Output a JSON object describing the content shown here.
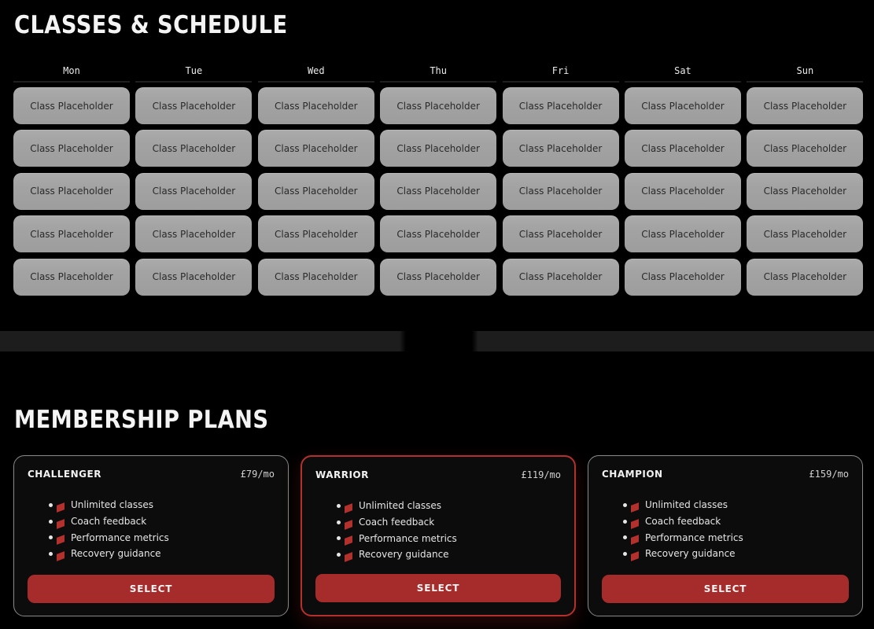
{
  "schedule": {
    "title": "CLASSES & SCHEDULE",
    "days": [
      "Mon",
      "Tue",
      "Wed",
      "Thu",
      "Fri",
      "Sat",
      "Sun"
    ],
    "rows": [
      [
        "Class Placeholder",
        "Class Placeholder",
        "Class Placeholder",
        "Class Placeholder",
        "Class Placeholder",
        "Class Placeholder",
        "Class Placeholder"
      ],
      [
        "Class Placeholder",
        "Class Placeholder",
        "Class Placeholder",
        "Class Placeholder",
        "Class Placeholder",
        "Class Placeholder",
        "Class Placeholder"
      ],
      [
        "Class Placeholder",
        "Class Placeholder",
        "Class Placeholder",
        "Class Placeholder",
        "Class Placeholder",
        "Class Placeholder",
        "Class Placeholder"
      ],
      [
        "Class Placeholder",
        "Class Placeholder",
        "Class Placeholder",
        "Class Placeholder",
        "Class Placeholder",
        "Class Placeholder",
        "Class Placeholder"
      ],
      [
        "Class Placeholder",
        "Class Placeholder",
        "Class Placeholder",
        "Class Placeholder",
        "Class Placeholder",
        "Class Placeholder",
        "Class Placeholder"
      ]
    ]
  },
  "membership": {
    "title": "MEMBERSHIP PLANS",
    "plans": [
      {
        "name": "CHALLENGER",
        "price": "£79/mo",
        "features": [
          "Unlimited classes",
          "Coach feedback",
          "Performance metrics",
          "Recovery guidance"
        ],
        "button_label": "SELECT"
      },
      {
        "name": "WARRIOR",
        "price": "£119/mo",
        "features": [
          "Unlimited classes",
          "Coach feedback",
          "Performance metrics",
          "Recovery guidance"
        ],
        "button_label": "SELECT"
      },
      {
        "name": "CHAMPION",
        "price": "£159/mo",
        "features": [
          "Unlimited classes",
          "Coach feedback",
          "Performance metrics",
          "Recovery guidance"
        ],
        "button_label": "SELECT"
      }
    ]
  },
  "colors": {
    "accent": "#a62b2b",
    "featured_border": "#b3312c",
    "background": "#000000",
    "cell": "#a3a3a3"
  },
  "icons": {
    "feature_marker": "red-flag-icon"
  }
}
